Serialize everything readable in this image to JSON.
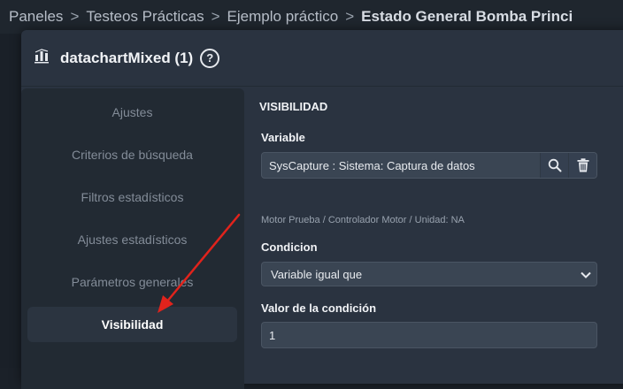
{
  "breadcrumb": {
    "items": [
      "Paneles",
      "Testeos Prácticas",
      "Ejemplo práctico"
    ],
    "current": "Estado General Bomba Princi",
    "separator": ">"
  },
  "modal": {
    "title": "datachartMixed (1)",
    "help": "?",
    "icon": "bar-chart-icon"
  },
  "sidebar": {
    "items": [
      {
        "label": "Ajustes"
      },
      {
        "label": "Criterios de búsqueda"
      },
      {
        "label": "Filtros estadísticos"
      },
      {
        "label": "Ajustes estadísticos"
      },
      {
        "label": "Parámetros generales"
      },
      {
        "label": "Visibilidad"
      }
    ],
    "active_index": 5
  },
  "content": {
    "section_title": "VISIBILIDAD",
    "variable": {
      "label": "Variable",
      "value": "SysCapture : Sistema: Captura de datos",
      "hint": "Motor Prueba / Controlador Motor / Unidad: NA",
      "search_icon": "search-icon",
      "delete_icon": "trash-icon"
    },
    "condicion": {
      "label": "Condicion",
      "selected": "Variable igual que"
    },
    "valor": {
      "label": "Valor de la condición",
      "value": "1"
    }
  },
  "colors": {
    "accent_arrow": "#e0231c",
    "panel_bg": "#2a3340",
    "sidebar_bg": "#222a33"
  }
}
